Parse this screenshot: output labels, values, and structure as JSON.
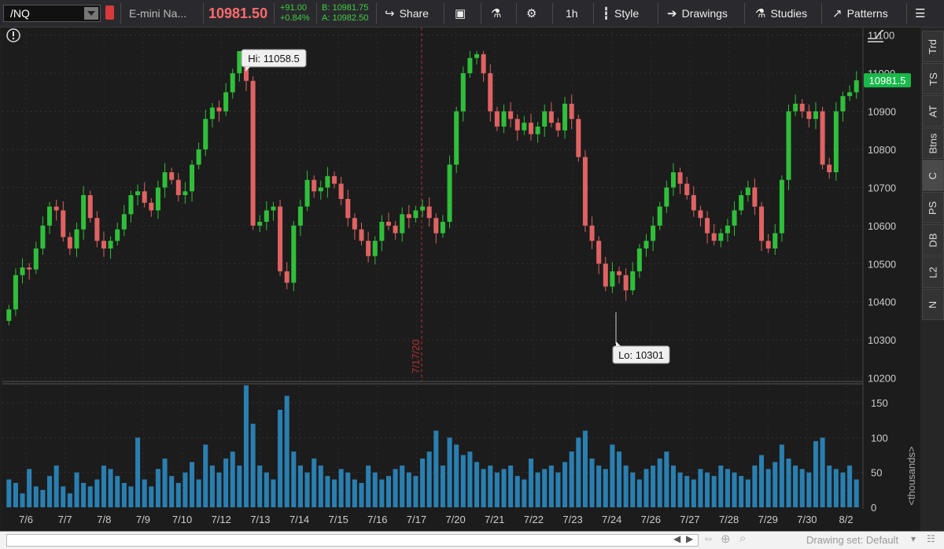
{
  "toolbar": {
    "symbol": "/NQ",
    "description": "E-mini Na...",
    "last_price": "10981.50",
    "net_change": "+91.00",
    "pct_change": "+0.84%",
    "bid": "B: 10981.75",
    "ask": "A: 10982.50",
    "share_label": "Share",
    "timeframe": "1h",
    "style_label": "Style",
    "drawings_label": "Drawings",
    "studies_label": "Studies",
    "patterns_label": "Patterns"
  },
  "side_tabs": [
    "Trd",
    "TS",
    "AT",
    "Btns",
    "C",
    "PS",
    "DB",
    "L2",
    "N"
  ],
  "active_side_tab": "C",
  "bottom": {
    "drawing_set": "Drawing set: Default"
  },
  "colors": {
    "up": "#2fbf3a",
    "down": "#e06262",
    "volume": "#2a7fb0",
    "price_badge": "#18b84a",
    "marker": "#b33030"
  },
  "chart_data": {
    "type": "candlestick",
    "price_axis": {
      "ticks": [
        10200,
        10300,
        10400,
        10500,
        10600,
        10700,
        10800,
        10900,
        11000,
        11100
      ],
      "range": [
        10195,
        11120
      ]
    },
    "volume_axis": {
      "ticks": [
        50,
        100,
        150
      ],
      "range": [
        0,
        175
      ],
      "label": "<thousands>"
    },
    "x_labels": [
      "7/6",
      "7/7",
      "7/8",
      "7/9",
      "7/10",
      "7/12",
      "7/13",
      "7/14",
      "7/15",
      "7/16",
      "7/17",
      "7/20",
      "7/21",
      "7/22",
      "7/23",
      "7/24",
      "7/26",
      "7/27",
      "7/28",
      "7/29",
      "7/30",
      "8/2"
    ],
    "high_label": "Hi: 11058.5",
    "low_label": "Lo: 10301",
    "high": 11058.5,
    "low": 10301,
    "current_price_label": "10981.5",
    "current_price": 10981.5,
    "marker_date": "7/17/20",
    "close_path": [
      10380,
      10470,
      10490,
      10485,
      10540,
      10600,
      10650,
      10640,
      10570,
      10540,
      10590,
      10680,
      10620,
      10560,
      10540,
      10560,
      10590,
      10630,
      10680,
      10690,
      10660,
      10640,
      10700,
      10740,
      10720,
      10680,
      10690,
      10760,
      10800,
      10880,
      10910,
      10900,
      10950,
      11000,
      11058,
      10980,
      10600,
      10610,
      10640,
      10650,
      10480,
      10450,
      10600,
      10650,
      10720,
      10690,
      10700,
      10730,
      10710,
      10670,
      10620,
      10590,
      10560,
      10520,
      10560,
      10610,
      10600,
      10580,
      10630,
      10620,
      10640,
      10650,
      10620,
      10580,
      10610,
      10760,
      10900,
      11000,
      11040,
      11050,
      11000,
      10900,
      10860,
      10900,
      10880,
      10850,
      10870,
      10840,
      10860,
      10900,
      10870,
      10850,
      10920,
      10880,
      10780,
      10600,
      10560,
      10500,
      10440,
      10480,
      10470,
      10430,
      10480,
      10540,
      10560,
      10600,
      10650,
      10700,
      10740,
      10710,
      10680,
      10640,
      10620,
      10580,
      10560,
      10580,
      10600,
      10640,
      10680,
      10700,
      10650,
      10560,
      10540,
      10580,
      10720,
      10900,
      10920,
      10900,
      10880,
      10900,
      10760,
      10740,
      10900,
      10940,
      10950,
      10981.5
    ],
    "volume": [
      40,
      35,
      20,
      55,
      30,
      25,
      45,
      60,
      30,
      20,
      50,
      35,
      30,
      40,
      60,
      55,
      45,
      35,
      30,
      100,
      40,
      30,
      55,
      70,
      45,
      35,
      50,
      65,
      40,
      90,
      60,
      50,
      70,
      80,
      60,
      175,
      120,
      60,
      50,
      40,
      140,
      160,
      80,
      60,
      50,
      70,
      60,
      45,
      40,
      55,
      50,
      40,
      35,
      60,
      50,
      40,
      45,
      55,
      60,
      50,
      45,
      70,
      80,
      110,
      60,
      100,
      90,
      75,
      80,
      65,
      55,
      60,
      50,
      55,
      60,
      45,
      40,
      70,
      50,
      55,
      60,
      50,
      65,
      80,
      100,
      110,
      70,
      60,
      55,
      90,
      80,
      60,
      50,
      40,
      55,
      60,
      70,
      80,
      60,
      50,
      45,
      40,
      55,
      50,
      45,
      60,
      55,
      50,
      45,
      40,
      60,
      75,
      55,
      65,
      90,
      70,
      60,
      55,
      50,
      95,
      100,
      60,
      55,
      50,
      60,
      40
    ]
  }
}
